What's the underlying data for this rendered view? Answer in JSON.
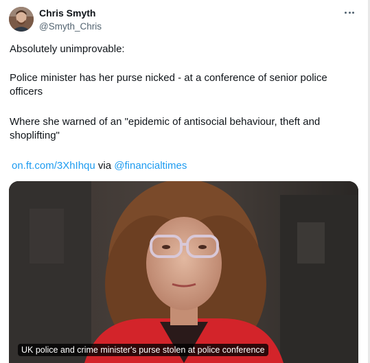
{
  "author": {
    "name": "Chris Smyth",
    "handle": "@Smyth_Chris"
  },
  "tweet": {
    "line1": "Absolutely unimprovable:",
    "line2": "Police minister has her purse nicked - at a conference of senior police officers",
    "line3": "Where she warned of an \"epidemic of antisocial behaviour, theft and shoplifting\"",
    "link_url_text": "on.ft.com/3XhIhqu",
    "via_text": "via",
    "via_handle": "@financialtimes"
  },
  "media": {
    "caption": "UK police and crime minister's purse stolen at police conference"
  },
  "colors": {
    "link": "#1d9bf0",
    "text": "#0f1419",
    "secondary": "#536471"
  },
  "icons": {
    "more": "more-horizontal-icon"
  }
}
